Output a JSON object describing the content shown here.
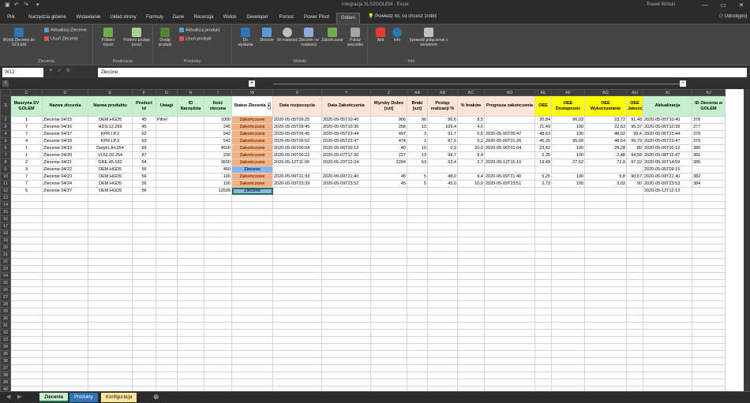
{
  "window": {
    "title": "Integracja XLS2GOLEM - Excel",
    "user": "Paweł Wolski",
    "minimize": "—",
    "restore": "▭",
    "close": "✕"
  },
  "tabs": [
    "Plik",
    "Narzędzia główne",
    "Wstawianie",
    "Układ strony",
    "Formuły",
    "Dane",
    "Recenzja",
    "Widok",
    "Developer",
    "Pomoc",
    "Power Pivot",
    "Golem"
  ],
  "tell_me": "Powiedz mi, co chcesz zrobić",
  "share": "Udostępnij",
  "ribbon": {
    "groups": [
      "Zlecenia",
      "Realizacja",
      "Produkty",
      "Widoki",
      "Info"
    ],
    "zlecenia": {
      "big": "Wyślij Zlecenie do GOLEM",
      "small": [
        "Aktualizuj Zlecenie",
        "Usuń Zlecenie"
      ]
    },
    "realizacja": [
      "Pobierz report",
      "Pobierz postęp (now)"
    ],
    "produkty": {
      "big": "Dodaj produkt",
      "small": [
        "Aktualizuj produkt",
        "Usuń produkt"
      ]
    },
    "widoki": [
      "Do wysłania",
      "Zlecone",
      "W realizacji",
      "Zlecone i w realizacji",
      "Zakończone",
      "Pokaż wszystko"
    ],
    "info": [
      "Abit",
      "Info",
      "Sprawdź połączenie z serwerem"
    ]
  },
  "formula": {
    "name_box": "W12",
    "fx": "fx",
    "value": "Zlecone"
  },
  "columns": [
    "C",
    "D",
    "E",
    "F",
    "G",
    "H",
    "I",
    "W",
    "X",
    "Y",
    "Z",
    "AA",
    "AB",
    "AC",
    "AD",
    "AE",
    "AF",
    "AG",
    "AH",
    "AI",
    "AJ"
  ],
  "headers": [
    "Maszyna SV GOLEM",
    "Nazwa zlecenia",
    "Nazwa produktu",
    "Product Id",
    "Uwagi",
    "ID Narzędzia",
    "Ilość zlecona",
    "Status Zlecenia",
    "Data rozpoczęcia",
    "Data Zakończenia",
    "Wyroby Dobre [szt]",
    "Braki [szt]",
    "Postęp realizacji %",
    "% braków",
    "Prognoza zakończenia",
    "OEE",
    "OEE Dostępność",
    "OEE Wykorzystanie",
    "OEE Jakość",
    "Aktualizacja",
    "ID Zlecenia w GOLEM"
  ],
  "rows": [
    [
      "1",
      "Zlecenie 04/15",
      "OEM.HGD5",
      "45",
      "",
      "",
      "1000",
      "Zakończone",
      "2020-05-05T09:25",
      "2020-05-05T10:40",
      "966",
      "90",
      "96,6",
      "8,5",
      "",
      "20,84",
      "96,03",
      "23,72",
      "91,48",
      "2020-05-05T10:40",
      "376"
    ],
    [
      "7",
      "Zlecenie 04/16",
      "HDS.12.259",
      "45",
      "",
      "",
      "245",
      "Zakończone",
      "2020-05-05T09:45",
      "2020-05-05T10:36",
      "268",
      "13",
      "109,4",
      "4,6",
      "",
      "21,49",
      "100",
      "22,53",
      "95,37",
      "2020-05-05T10:39",
      "377"
    ],
    [
      "7",
      "Zlecenie 04/17",
      "KPR.I.P.2",
      "62",
      "",
      "",
      "542",
      "Zakończone",
      "2020-05-05T09:45",
      "2020-05-05T23:44",
      "497",
      "3",
      "91,7",
      "0,6",
      "2020-05-06T00:47",
      "48,63",
      "100",
      "48,92",
      "99,4",
      "2020-05-05T23:44",
      "378"
    ],
    [
      "4",
      "Zlecenie 04/18",
      "KPR.I.P.3",
      "63",
      "",
      "",
      "542",
      "Zakończone",
      "2020-05-05T09:52",
      "2020-05-05T23:47",
      "474",
      "1",
      "87,5",
      "0,2",
      "2020-05-06T01:26",
      "46,35",
      "95,68",
      "48,54",
      "99,79",
      "2020-05-05T23:47",
      "379"
    ],
    [
      "1",
      "Zlecenie 04/19",
      "Delphi.JH.254",
      "65",
      "",
      "",
      "4500",
      "Zakończone",
      "2020-05-06T00:04",
      "2020-05-06T00:12",
      "40",
      "10",
      "0,9",
      "20,0",
      "2020-05-06T01:04",
      "23,42",
      "100",
      "29,28",
      "80",
      "2020-05-06T00:12",
      "380"
    ],
    [
      "1",
      "Zlecenie 04/20",
      "VL52.00.254",
      "87",
      "",
      "",
      "230",
      "Zakończone",
      "2020-05-06T00:22",
      "2020-05-07T17:30",
      "227",
      "13",
      "98,7",
      "5,4",
      "",
      "2,35",
      "100",
      "2,48",
      "94,58",
      "2020-05-08T15:47",
      "381"
    ],
    [
      "2",
      "Zlecenie 04/21",
      "GRE.45.032",
      "54",
      "",
      "",
      "3600",
      "Zakończone",
      "2020-05-12T11:09",
      "2020-05-20T12:24",
      "2284",
      "63",
      "63,4",
      "2,7",
      "2020-05-12T15:16",
      "19,49",
      "27,52",
      "72,8",
      "97,32",
      "2020-05-20T14:59",
      "385"
    ],
    [
      "9",
      "Zlecenie 04/22",
      "OEM.HGD5",
      "56",
      "",
      "",
      "450",
      "Zlecone",
      "",
      "",
      "",
      "",
      "",
      "",
      "",
      "",
      "",
      "",
      "",
      "2020-05-05T09:15",
      ""
    ],
    [
      "7",
      "Zlecenie 04/23",
      "OEM.HGD5",
      "56",
      "",
      "",
      "100",
      "Zakończone",
      "2020-05-09T21:33",
      "2020-05-09T21:40",
      "45",
      "5",
      "48,0",
      "9,4",
      "2020-05-09T21:40",
      "5,25",
      "100",
      "5,8",
      "90,57",
      "2020-05-09T21:40",
      "382"
    ],
    [
      "7",
      "Zlecenie 04/24",
      "OEM.HGD5",
      "56",
      "",
      "",
      "100",
      "Zakończone",
      "2020-05-09T23:39",
      "2020-05-09T23:52",
      "45",
      "5",
      "45,0",
      "10,0",
      "2020-05-09T23:51",
      "2,73",
      "100",
      "3,03",
      "90",
      "2020-05-09T23:53",
      "384"
    ],
    [
      "5",
      "Zlecenie 04/27",
      "OEM.HGD5",
      "56",
      "",
      "",
      "12595",
      "Zlecone",
      "",
      "",
      "",
      "",
      "",
      "",
      "",
      "",
      "",
      "",
      "",
      "2020-05-12T12:13",
      ""
    ]
  ],
  "g_note": "Pilne!",
  "sheets": [
    "Zlecenia",
    "Produkty",
    "Konfiguracja"
  ],
  "colors": {
    "header_green": "#c6efce",
    "header_peach": "#fce4d6",
    "header_yellow": "#ffff00",
    "status_done": "#f4b183",
    "status_ordered": "#8eb4e3"
  }
}
